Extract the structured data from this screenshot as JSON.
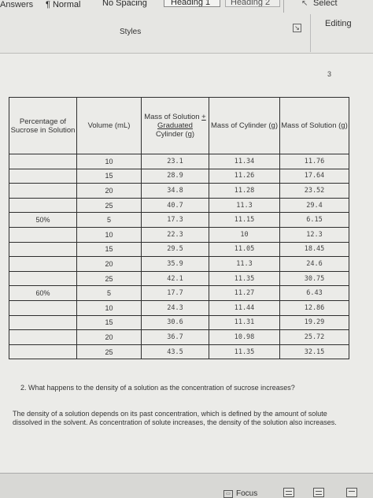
{
  "ribbon": {
    "styles": {
      "answers": "Answers",
      "normal": "¶ Normal",
      "no_spacing": "No Spacing",
      "heading1": "Heading 1",
      "heading2": "Heading 2"
    },
    "group_label": "Styles",
    "select_label": "Select",
    "editing_label": "Editing"
  },
  "page": {
    "page_number": "3",
    "table": {
      "headers": {
        "percentage": "Percentage of Sucrose in Solution",
        "volume": "Volume (mL)",
        "mass_solution_cylinder_line1": "Mass of Solution",
        "mass_solution_cylinder_plus": "+",
        "mass_solution_cylinder_line2": "Graduated",
        "mass_solution_cylinder_line3": "Cylinder (g)",
        "mass_cylinder": "Mass of Cylinder (g)",
        "mass_solution": "Mass of Solution (g)"
      },
      "rows": [
        {
          "percent": "",
          "volume": "10",
          "mass_sc": "23.1",
          "mass_c": "11.34",
          "mass_s": "11.76"
        },
        {
          "percent": "",
          "volume": "15",
          "mass_sc": "28.9",
          "mass_c": "11.26",
          "mass_s": "17.64"
        },
        {
          "percent": "",
          "volume": "20",
          "mass_sc": "34.8",
          "mass_c": "11.28",
          "mass_s": "23.52"
        },
        {
          "percent": "",
          "volume": "25",
          "mass_sc": "40.7",
          "mass_c": "11.3",
          "mass_s": "29.4"
        },
        {
          "percent": "50%",
          "volume": "5",
          "mass_sc": "17.3",
          "mass_c": "11.15",
          "mass_s": "6.15"
        },
        {
          "percent": "",
          "volume": "10",
          "mass_sc": "22.3",
          "mass_c": "10",
          "mass_s": "12.3"
        },
        {
          "percent": "",
          "volume": "15",
          "mass_sc": "29.5",
          "mass_c": "11.05",
          "mass_s": "18.45"
        },
        {
          "percent": "",
          "volume": "20",
          "mass_sc": "35.9",
          "mass_c": "11.3",
          "mass_s": "24.6"
        },
        {
          "percent": "",
          "volume": "25",
          "mass_sc": "42.1",
          "mass_c": "11.35",
          "mass_s": "30.75"
        },
        {
          "percent": "60%",
          "volume": "5",
          "mass_sc": "17.7",
          "mass_c": "11.27",
          "mass_s": "6.43"
        },
        {
          "percent": "",
          "volume": "10",
          "mass_sc": "24.3",
          "mass_c": "11.44",
          "mass_s": "12.86"
        },
        {
          "percent": "",
          "volume": "15",
          "mass_sc": "30.6",
          "mass_c": "11.31",
          "mass_s": "19.29"
        },
        {
          "percent": "",
          "volume": "20",
          "mass_sc": "36.7",
          "mass_c": "10.98",
          "mass_s": "25.72"
        },
        {
          "percent": "",
          "volume": "25",
          "mass_sc": "43.5",
          "mass_c": "11.35",
          "mass_s": "32.15"
        }
      ]
    },
    "question": "2.  What happens to the density of a solution as the concentration of sucrose increases?",
    "answer": "The density of a solution depends on its past concentration, which is defined by the amount of solute dissolved in the solvent. As concentration of solute increases, the density of the solution also increases."
  },
  "status_bar": {
    "focus_label": "Focus"
  }
}
